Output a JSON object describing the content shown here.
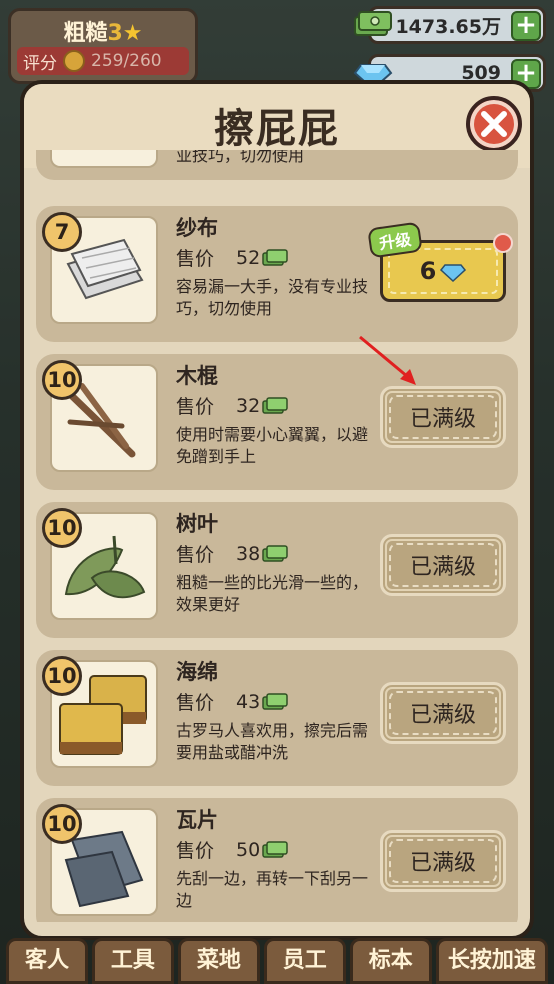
{
  "top_left": {
    "rank_label": "粗糙",
    "rank_level": "3",
    "score_label": "评分",
    "score_value": "259/260"
  },
  "currencies": {
    "money": "1473.65万",
    "gems": "509"
  },
  "dialog": {
    "title": "擦屁屁",
    "cut_item_desc": "业技巧，切勿使用",
    "items": [
      {
        "level": "7",
        "name": "纱布",
        "price_label": "售价",
        "price": "52",
        "desc": "容易漏一大手，没有专业技巧，切勿使用",
        "action": "upgrade",
        "upgrade_tag": "升级",
        "upgrade_cost": "6"
      },
      {
        "level": "10",
        "name": "木棍",
        "price_label": "售价",
        "price": "32",
        "desc": "使用时需要小心翼翼，以避免蹭到手上",
        "action": "maxed",
        "maxed_label": "已满级"
      },
      {
        "level": "10",
        "name": "树叶",
        "price_label": "售价",
        "price": "38",
        "desc": "粗糙一些的比光滑一些的，效果更好",
        "action": "maxed",
        "maxed_label": "已满级"
      },
      {
        "level": "10",
        "name": "海绵",
        "price_label": "售价",
        "price": "43",
        "desc": "古罗马人喜欢用，擦完后需要用盐或醋冲洗",
        "action": "maxed",
        "maxed_label": "已满级"
      },
      {
        "level": "10",
        "name": "瓦片",
        "price_label": "售价",
        "price": "50",
        "desc": "先刮一边，再转一下刮另一边",
        "action": "maxed",
        "maxed_label": "已满级"
      }
    ]
  },
  "bottom_nav": [
    "客人",
    "工具",
    "菜地",
    "员工",
    "标本",
    "长按加速"
  ]
}
